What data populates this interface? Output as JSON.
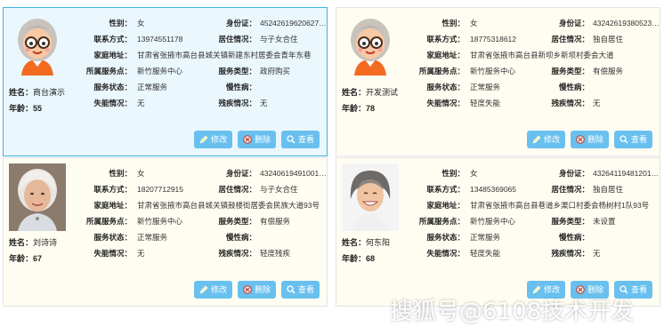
{
  "labels": {
    "gender": "性别：",
    "id_card": "身份证：",
    "contact": "联系方式：",
    "living": "居住情况：",
    "address": "家庭地址：",
    "service_point": "所属服务点：",
    "service_type": "服务类型：",
    "service_status": "服务状态：",
    "chronic": "慢性病：",
    "disability": "失能情况：",
    "handicap": "残疾情况：",
    "name": "姓名：",
    "age": "年龄："
  },
  "buttons": {
    "edit": "修改",
    "delete": "删除",
    "view": "查看"
  },
  "cards": [
    {
      "name": "商台演示",
      "age": "55",
      "gender": "女",
      "id_card": "452426196206270...",
      "contact": "13974551178",
      "living": "与子女合住",
      "address": "甘肃省张掖市高台县城关镇新建东村居委会青年东巷",
      "service_point": "新竹服务中心",
      "service_type": "政府购买",
      "service_status": "正常服务",
      "chronic": "",
      "disability": "无",
      "handicap": "无",
      "avatar": "cartoon-grandma"
    },
    {
      "name": "开发测试",
      "age": "78",
      "gender": "女",
      "id_card": "4324261938052​30...",
      "contact": "18775318612",
      "living": "独自居住",
      "address": "甘肃省张掖市高台县新坝乡新坝村委会大道",
      "service_point": "新竹服务中心",
      "service_type": "有偿服务",
      "service_status": "正常服务",
      "chronic": "",
      "disability": "轻度失能",
      "handicap": "无",
      "avatar": "cartoon-grandma"
    },
    {
      "name": "刘诗诗",
      "age": "67",
      "gender": "女",
      "id_card": "432406194910010...",
      "contact": "18207712915",
      "living": "与子女合住",
      "address": "甘肃省张掖市高台县城关镇鼓楼街居委会民族大道93号",
      "service_point": "新竹服务中心",
      "service_type": "有偿服务",
      "service_status": "正常服务",
      "chronic": "",
      "disability": "无",
      "handicap": "轻度残疾",
      "avatar": "photo-elderly-woman"
    },
    {
      "name": "何东阳",
      "age": "68",
      "gender": "女",
      "id_card": "432641194812010...",
      "contact": "13485369065",
      "living": "独自居住",
      "address": "甘肃省张掖市高台县巷道乡渠口村委会杨树村1队93号",
      "service_point": "新竹服务中心",
      "service_type": "未设置",
      "service_status": "正常服务",
      "chronic": "",
      "disability": "轻度失能",
      "handicap": "无",
      "avatar": "photo-smiling-woman"
    }
  ],
  "watermark": "搜狐号@6108技术开发",
  "colors": {
    "selected_border": "#3fb1e0",
    "selected_bg": "#eaf7fd",
    "card_bg": "#fffdf2",
    "button": "#69c0ef"
  }
}
